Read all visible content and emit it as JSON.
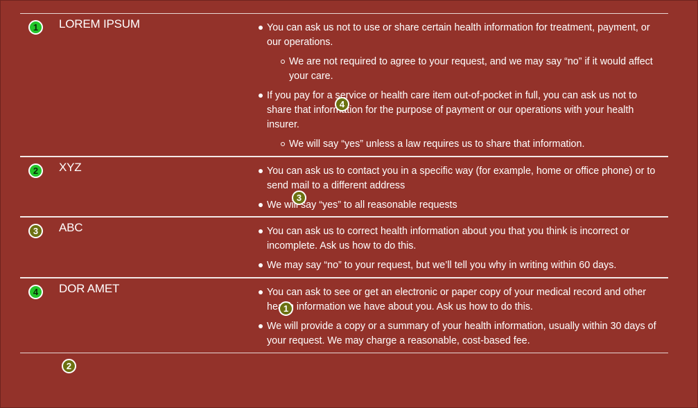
{
  "rows": [
    {
      "number": "1",
      "title": "LOREM IPSUM",
      "bullets": [
        "You can ask us not to use or share certain health information for treatment, payment, or our operations.",
        "If you pay for a service or health care item out-of-pocket in full, you can ask us not to share that information for the purpose of payment or our operations with your health insurer."
      ],
      "subs": [
        "We are not required to agree to your request, and we may say “no” if it would affect your care.",
        "We will say “yes” unless a law requires us to share that information."
      ]
    },
    {
      "number": "2",
      "title": "XYZ",
      "bullets": [
        "You can ask us to contact you in a specific way (for example, home or office phone) or to send mail to a different address",
        "We will say “yes” to all reasonable requests"
      ]
    },
    {
      "number": "3",
      "title": "ABC",
      "bullets": [
        "You can ask us to correct health information about you that you think is incorrect or incomplete. Ask us how to do this.",
        "We may say “no” to your request, but we’ll tell you why in writing within 60 days."
      ]
    },
    {
      "number": "4",
      "title": "DOR AMET",
      "bullets": [
        "You can ask to see or get an electronic or paper copy of your medical record and other health information we have about you. Ask us how to do this.",
        "We will provide a copy or a summary of your health information, usually within 30 days of your request. We may charge a reasonable, cost-based fee."
      ]
    }
  ],
  "markers": [
    "4",
    "3",
    "1",
    "2"
  ],
  "colors": {
    "background": "#93322a",
    "number_badge_green": "#22c62a",
    "marker_olive": "#6b7111",
    "text": "#ffffff"
  }
}
